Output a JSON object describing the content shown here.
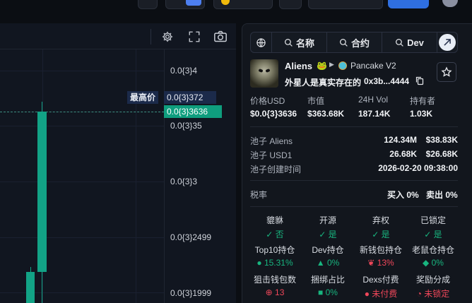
{
  "chart": {
    "y_labels": [
      "0.0{3}4",
      "0.0{3}35",
      "0.0{3}3",
      "0.0{3}2499",
      "0.0{3}1999"
    ],
    "high_label": "最高价",
    "high_value": "0.0{3}372",
    "current_value": "0.0{3}3636"
  },
  "search": {
    "name_label": "名称",
    "contract_label": "合约",
    "dev_label": "Dev"
  },
  "token": {
    "symbol": "Aliens",
    "dex": "Pancake V2",
    "full_name": "外星人是真实存在的",
    "address": "0x3b...4444"
  },
  "stats": [
    {
      "label": "价格USD",
      "value": "$0.0{3}3636"
    },
    {
      "label": "市值",
      "value": "$363.68K"
    },
    {
      "label": "24H Vol",
      "value": "187.14K"
    },
    {
      "label": "持有者",
      "value": "1.03K"
    }
  ],
  "pool": [
    {
      "label": "池子 Aliens",
      "amount": "124.34M",
      "usd": "$38.83K"
    },
    {
      "label": "池子 USD1",
      "amount": "26.68K",
      "usd": "$26.68K"
    },
    {
      "label": "池子创建时间",
      "amount": "2026-02-20 09:38:00",
      "usd": ""
    }
  ],
  "tax": {
    "label": "税率",
    "buy": "买入 0%",
    "sell": "卖出 0%"
  },
  "security_row1": [
    {
      "title": "貔貅",
      "value": "✓ 否",
      "color": "green"
    },
    {
      "title": "开源",
      "value": "✓ 是",
      "color": "green"
    },
    {
      "title": "弃权",
      "value": "✓ 是",
      "color": "green"
    },
    {
      "title": "已锁定",
      "value": "✓ 是",
      "color": "green"
    }
  ],
  "security_row2": [
    {
      "title": "Top10持仓",
      "value": "15.31%",
      "color": "green",
      "icon": "person-icon"
    },
    {
      "title": "Dev持仓",
      "value": "0%",
      "color": "green",
      "icon": "hat-icon"
    },
    {
      "title": "新钱包持仓",
      "value": "13%",
      "color": "red",
      "icon": "leaf-icon"
    },
    {
      "title": "老鼠仓持仓",
      "value": "0%",
      "color": "green",
      "icon": "rat-icon"
    }
  ],
  "security_row3": [
    {
      "title": "狙击钱包数",
      "value": "13",
      "color": "red",
      "icon": "crosshair-icon"
    },
    {
      "title": "捆绑占比",
      "value": "0%",
      "color": "green",
      "icon": "cube-icon"
    },
    {
      "title": "Dexs付费",
      "value": "未付费",
      "color": "red",
      "icon": "coin-icon"
    },
    {
      "title": "奖励分成",
      "value": "未锁定",
      "color": "red",
      "icon": "pie-icon"
    }
  ]
}
